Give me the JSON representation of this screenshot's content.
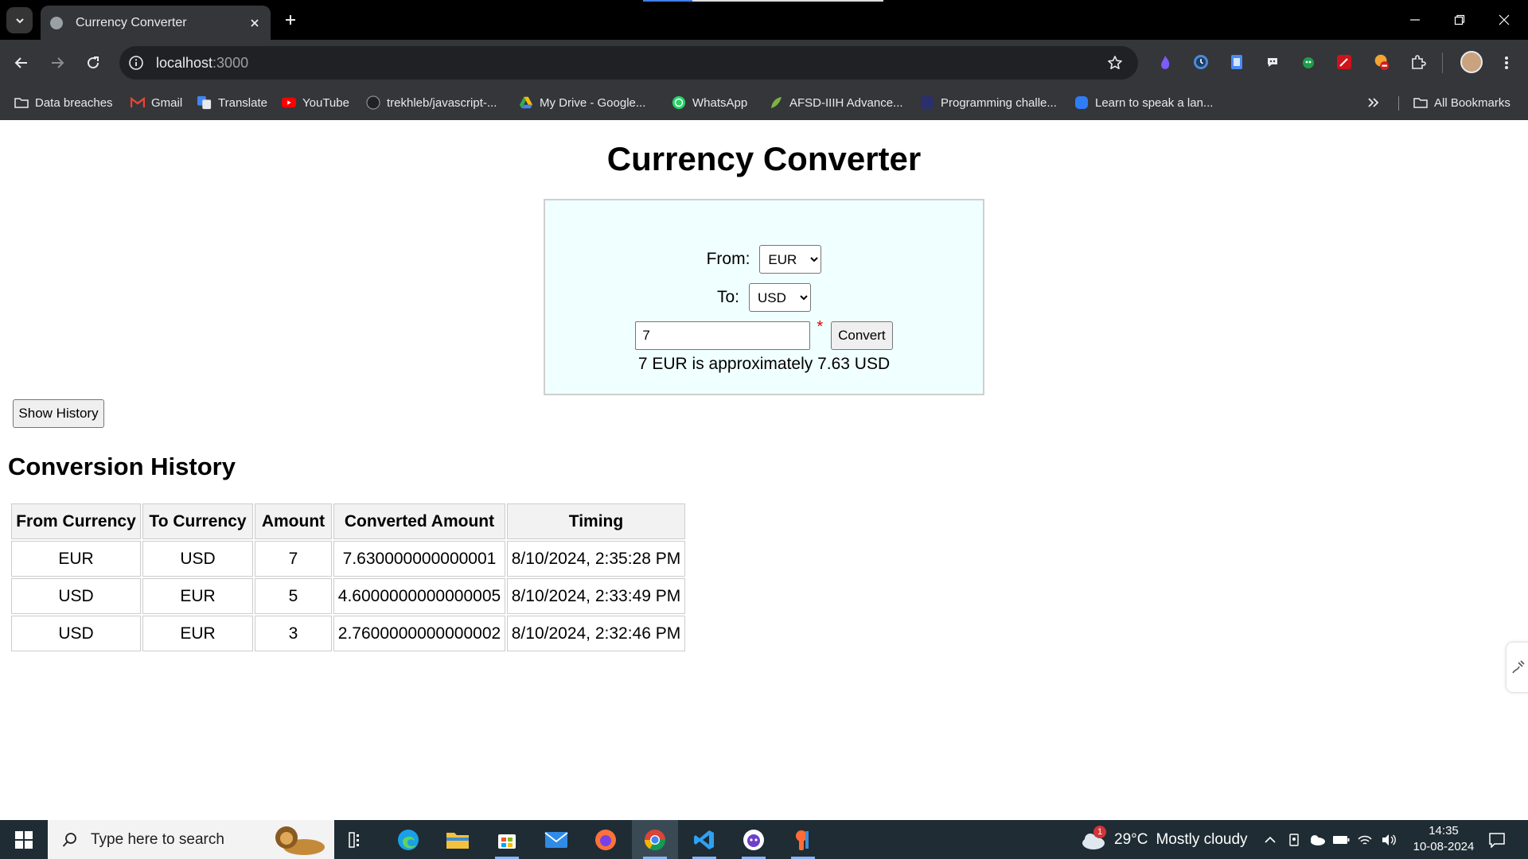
{
  "browser": {
    "tab": {
      "title": "Currency Converter"
    },
    "address": {
      "host": "localhost",
      "port": ":3000"
    },
    "bookmarks": [
      {
        "label": "Data breaches",
        "icon": "folder-icon"
      },
      {
        "label": "Gmail",
        "icon": "gmail-icon"
      },
      {
        "label": "Translate",
        "icon": "translate-icon"
      },
      {
        "label": "YouTube",
        "icon": "youtube-icon"
      },
      {
        "label": "trekhleb/javascript-...",
        "icon": "github-icon"
      },
      {
        "label": "My Drive - Google...",
        "icon": "drive-icon"
      },
      {
        "label": "WhatsApp",
        "icon": "whatsapp-icon"
      },
      {
        "label": "AFSD-IIIH Advance...",
        "icon": "leaf-icon"
      },
      {
        "label": "Programming challe...",
        "icon": "code-icon"
      },
      {
        "label": "Learn to speak a lan...",
        "icon": "language-icon"
      }
    ],
    "all_bookmarks": "All Bookmarks"
  },
  "app": {
    "title": "Currency Converter",
    "from_label": "From:",
    "from_value": "EUR",
    "to_label": "To:",
    "to_value": "USD",
    "amount_value": "7",
    "required_mark": "*",
    "convert_label": "Convert",
    "result_text": "7 EUR is approximately 7.63 USD",
    "show_history_label": "Show History",
    "history_heading": "Conversion History",
    "history_table": {
      "headers": [
        "From Currency",
        "To Currency",
        "Amount",
        "Converted Amount",
        "Timing"
      ],
      "rows": [
        [
          "EUR",
          "USD",
          "7",
          "7.630000000000001",
          "8/10/2024, 2:35:28 PM"
        ],
        [
          "USD",
          "EUR",
          "5",
          "4.6000000000000005",
          "8/10/2024, 2:33:49 PM"
        ],
        [
          "USD",
          "EUR",
          "3",
          "2.7600000000000002",
          "8/10/2024, 2:32:46 PM"
        ]
      ]
    }
  },
  "taskbar": {
    "search_placeholder": "Type here to search",
    "weather": {
      "temp": "29°C",
      "condition": "Mostly cloudy",
      "alert_count": "1"
    },
    "clock": {
      "time": "14:35",
      "date": "10-08-2024"
    }
  },
  "colors": {
    "card_background": "#f0ffff",
    "accent": "#8ab4f8",
    "required": "#e00000"
  }
}
